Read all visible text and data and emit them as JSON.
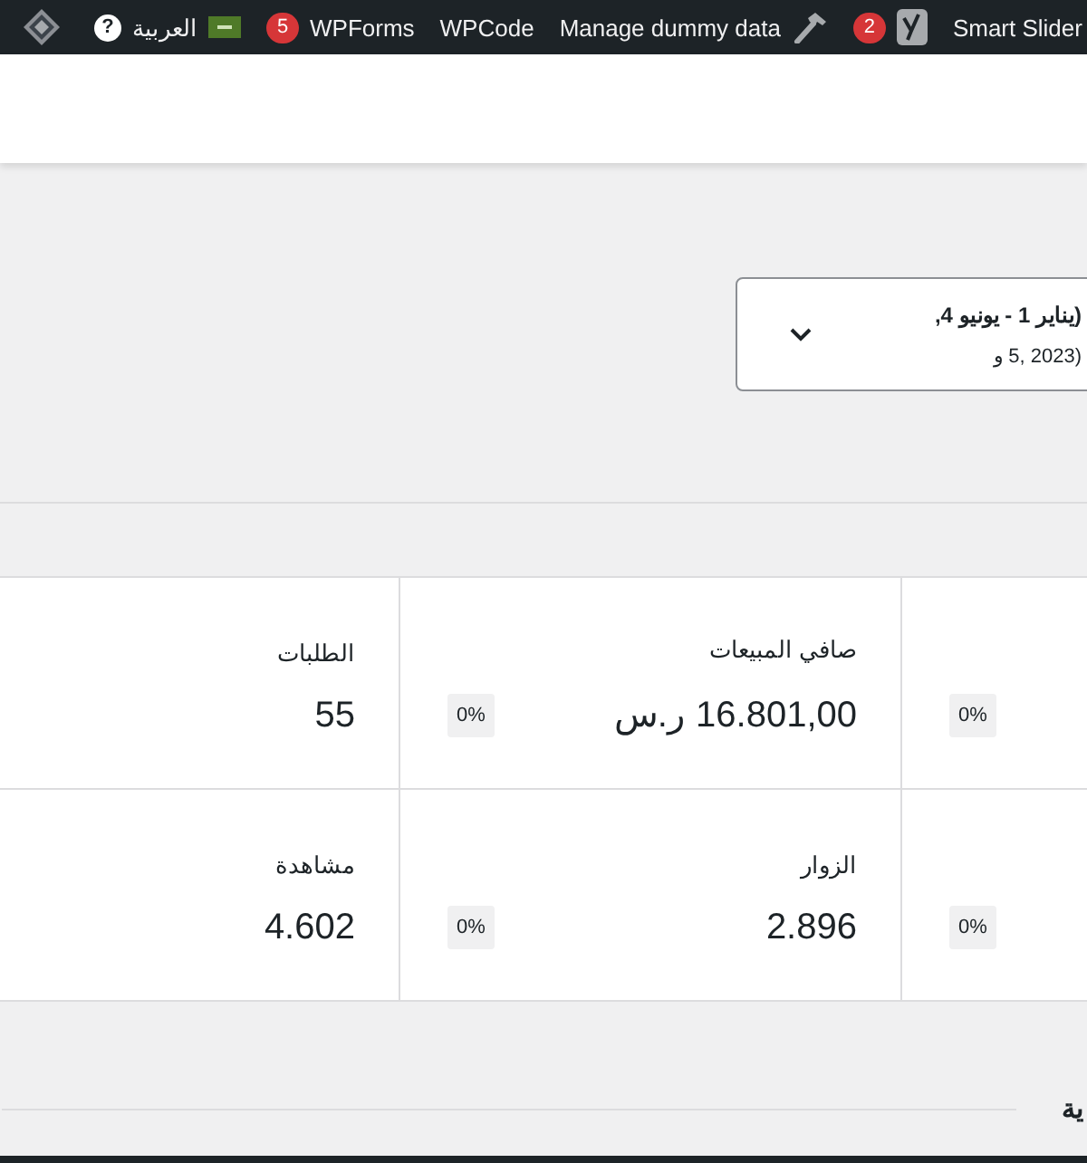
{
  "admin_bar": {
    "items": [
      {
        "kind": "plugin",
        "label": "Smart Slider"
      },
      {
        "kind": "seo",
        "count": "2"
      },
      {
        "kind": "tool",
        "label": "Manage dummy data"
      },
      {
        "kind": "plugin",
        "label": "WPCode"
      },
      {
        "kind": "plugin",
        "label": "WPForms",
        "count": "5"
      },
      {
        "kind": "language",
        "label": "العربية",
        "help": "?"
      },
      {
        "kind": "icon"
      }
    ]
  },
  "date_range": {
    "line_1": "(يناير 1 - يونيو 4,",
    "line_2": "و 5, 2023)"
  },
  "stats": [
    [
      {
        "change": "0%"
      },
      {
        "label": "صافي المبيعات",
        "value": "16.801,00 ر.س",
        "change": "0%"
      },
      {
        "label": "الطلبات",
        "value": "55"
      }
    ],
    [
      {
        "change": "0%"
      },
      {
        "label": "الزوار",
        "value": "2.896",
        "change": "0%"
      },
      {
        "label": "مشاهدة",
        "value": "4.602"
      }
    ]
  ],
  "section_heading": "ية"
}
